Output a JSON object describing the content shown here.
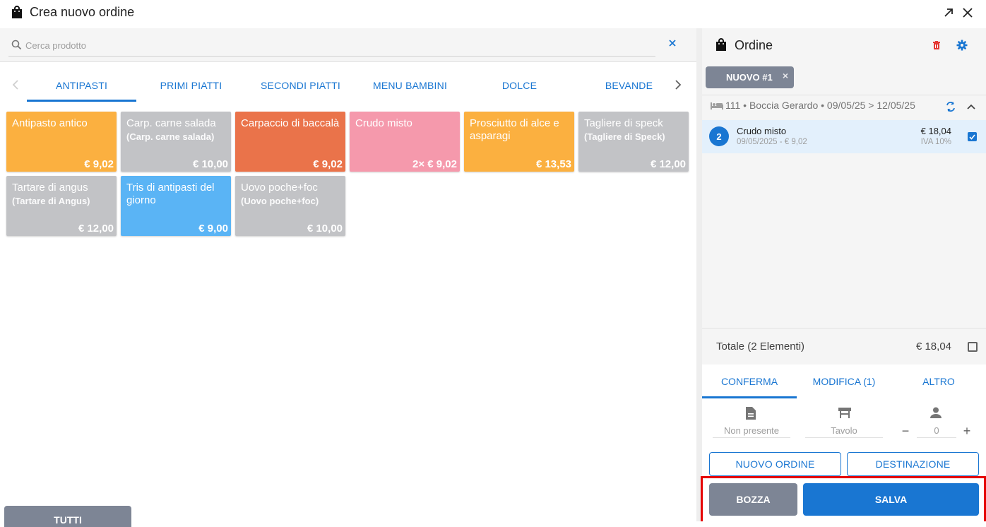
{
  "window": {
    "title": "Crea nuovo ordine",
    "icons": [
      "shopping-bag-icon",
      "expand-icon",
      "close-icon"
    ]
  },
  "search": {
    "placeholder": "Cerca prodotto",
    "value": ""
  },
  "categories": {
    "tabs": [
      "ANTIPASTI",
      "PRIMI PIATTI",
      "SECONDI PIATTI",
      "MENU BAMBINI",
      "DOLCE",
      "BEVANDE"
    ],
    "active": "ANTIPASTI",
    "accent": "#1976d2"
  },
  "products": [
    {
      "name": "Antipasto antico",
      "sub": "",
      "price": "€ 9,02",
      "color": "#fbb040"
    },
    {
      "name": "Carp. carne salada",
      "sub": "(Carp. carne salada)",
      "price": "€ 10,00",
      "color": "#c2c3c6"
    },
    {
      "name": "Carpaccio di baccalà",
      "sub": "",
      "price": "€ 9,02",
      "color": "#ea734a"
    },
    {
      "name": "Crudo misto",
      "sub": "",
      "price": "2× € 9,02",
      "color": "#f599ac"
    },
    {
      "name": "Prosciutto di alce e asparagi",
      "sub": "",
      "price": "€ 13,53",
      "color": "#fbb040"
    },
    {
      "name": "Tagliere di speck",
      "sub": "(Tagliere di Speck)",
      "price": "€ 12,00",
      "color": "#c2c3c6"
    },
    {
      "name": "Tartare di angus",
      "sub": "(Tartare di Angus)",
      "price": "€ 12,00",
      "color": "#c2c3c6"
    },
    {
      "name": "Tris di antipasti del giorno",
      "sub": "",
      "price": "€ 9,00",
      "color": "#5ab4f5"
    },
    {
      "name": "Uovo poche+foc",
      "sub": "(Uovo poche+foc)",
      "price": "€ 10,00",
      "color": "#c2c3c6"
    }
  ],
  "tutti_label": "TUTTI",
  "order": {
    "title": "Ordine",
    "chip_label": "NUOVO #1",
    "chip_close": "×",
    "booking": "111 • Boccia Gerardo • 09/05/25 > 12/05/25",
    "items": [
      {
        "qty": "2",
        "name": "Crudo misto",
        "sub": "09/05/2025 - € 9,02",
        "price": "€ 18,04",
        "vat": "IVA 10%",
        "checked": true
      }
    ],
    "total_label": "Totale (2 Elementi)",
    "total_value": "€ 18,04",
    "tabs": [
      "CONFERMA",
      "MODIFICA (1)",
      "ALTRO"
    ],
    "active_tab": "CONFERMA",
    "fields": {
      "document_placeholder": "Non presente",
      "table_placeholder": "Tavolo",
      "guests_placeholder": "0",
      "minus": "−",
      "plus": "+"
    },
    "buttons": {
      "new_order": "NUOVO ORDINE",
      "destination": "DESTINAZIONE",
      "draft": "BOZZA",
      "save": "SALVA"
    },
    "colors": {
      "delete": "#e53935",
      "settings": "#1976d2",
      "draft": "#7d8595",
      "save": "#1976d2",
      "highlight": "#e50000"
    }
  }
}
